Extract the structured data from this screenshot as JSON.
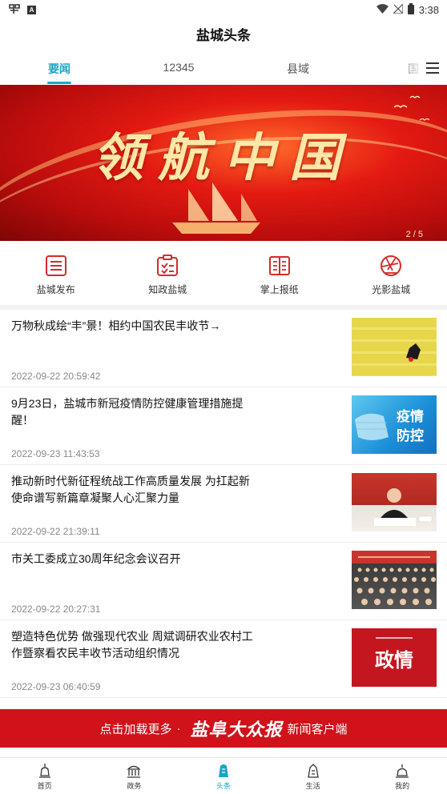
{
  "status_bar": {
    "time": "3:38",
    "left_icons": [
      "carrier-logo-icon",
      "a-icon"
    ],
    "right_icons": [
      "wifi-icon",
      "no-signal-icon",
      "battery-icon"
    ]
  },
  "app": {
    "title": "盐城头条"
  },
  "tabs": [
    {
      "label": "要闻",
      "active": true
    },
    {
      "label": "12345",
      "active": false
    },
    {
      "label": "县域",
      "active": false
    },
    {
      "label": "国",
      "active": false
    }
  ],
  "banner": {
    "headline": "领航中国",
    "indicator": "2 / 5"
  },
  "shortcuts": [
    {
      "label": "盐城发布",
      "icon": "list-icon"
    },
    {
      "label": "知政盐城",
      "icon": "clipboard-check-icon"
    },
    {
      "label": "掌上报纸",
      "icon": "newspaper-icon"
    },
    {
      "label": "光影盐城",
      "icon": "aperture-icon"
    }
  ],
  "news": [
    {
      "title": "万物秋成绘“丰”景！相约中国农民丰收节→",
      "time": "2022-09-22 20:59:42",
      "thumb": "harvest"
    },
    {
      "title": "9月23日，盐城市新冠疫情防控健康管理措施提醒！",
      "time": "2022-09-23 11:43:53",
      "thumb": "epidemic",
      "thumb_text": "疫情\n防控"
    },
    {
      "title": "推动新时代新征程统战工作高质量发展 为扛起新使命谱写新篇章凝聚人心汇聚力量",
      "time": "2022-09-22 21:39:11",
      "thumb": "speaker"
    },
    {
      "title": "市关工委成立30周年纪念会议召开",
      "time": "2022-09-22 20:27:31",
      "thumb": "meeting"
    },
    {
      "title": "塑造特色优势 做强现代农业 周斌调研农业农村工作暨察看农民丰收节活动组织情况",
      "time": "2022-09-23 06:40:59",
      "thumb": "politics",
      "thumb_text": "政情"
    }
  ],
  "promo": {
    "prefix": "点击加载更多",
    "dot": "·",
    "brand": "盐阜大众报",
    "suffix": "新闻客户端"
  },
  "bottom_nav": [
    {
      "label": "首页",
      "icon": "home-icon",
      "active": false
    },
    {
      "label": "政务",
      "icon": "government-icon",
      "active": false
    },
    {
      "label": "头条",
      "icon": "headline-icon",
      "active": true
    },
    {
      "label": "生活",
      "icon": "life-icon",
      "active": false
    },
    {
      "label": "我的",
      "icon": "profile-icon",
      "active": false
    }
  ],
  "colors": {
    "accent": "#1aa6c8",
    "brand_red": "#d0121b",
    "icon_red": "#d42b2b"
  }
}
